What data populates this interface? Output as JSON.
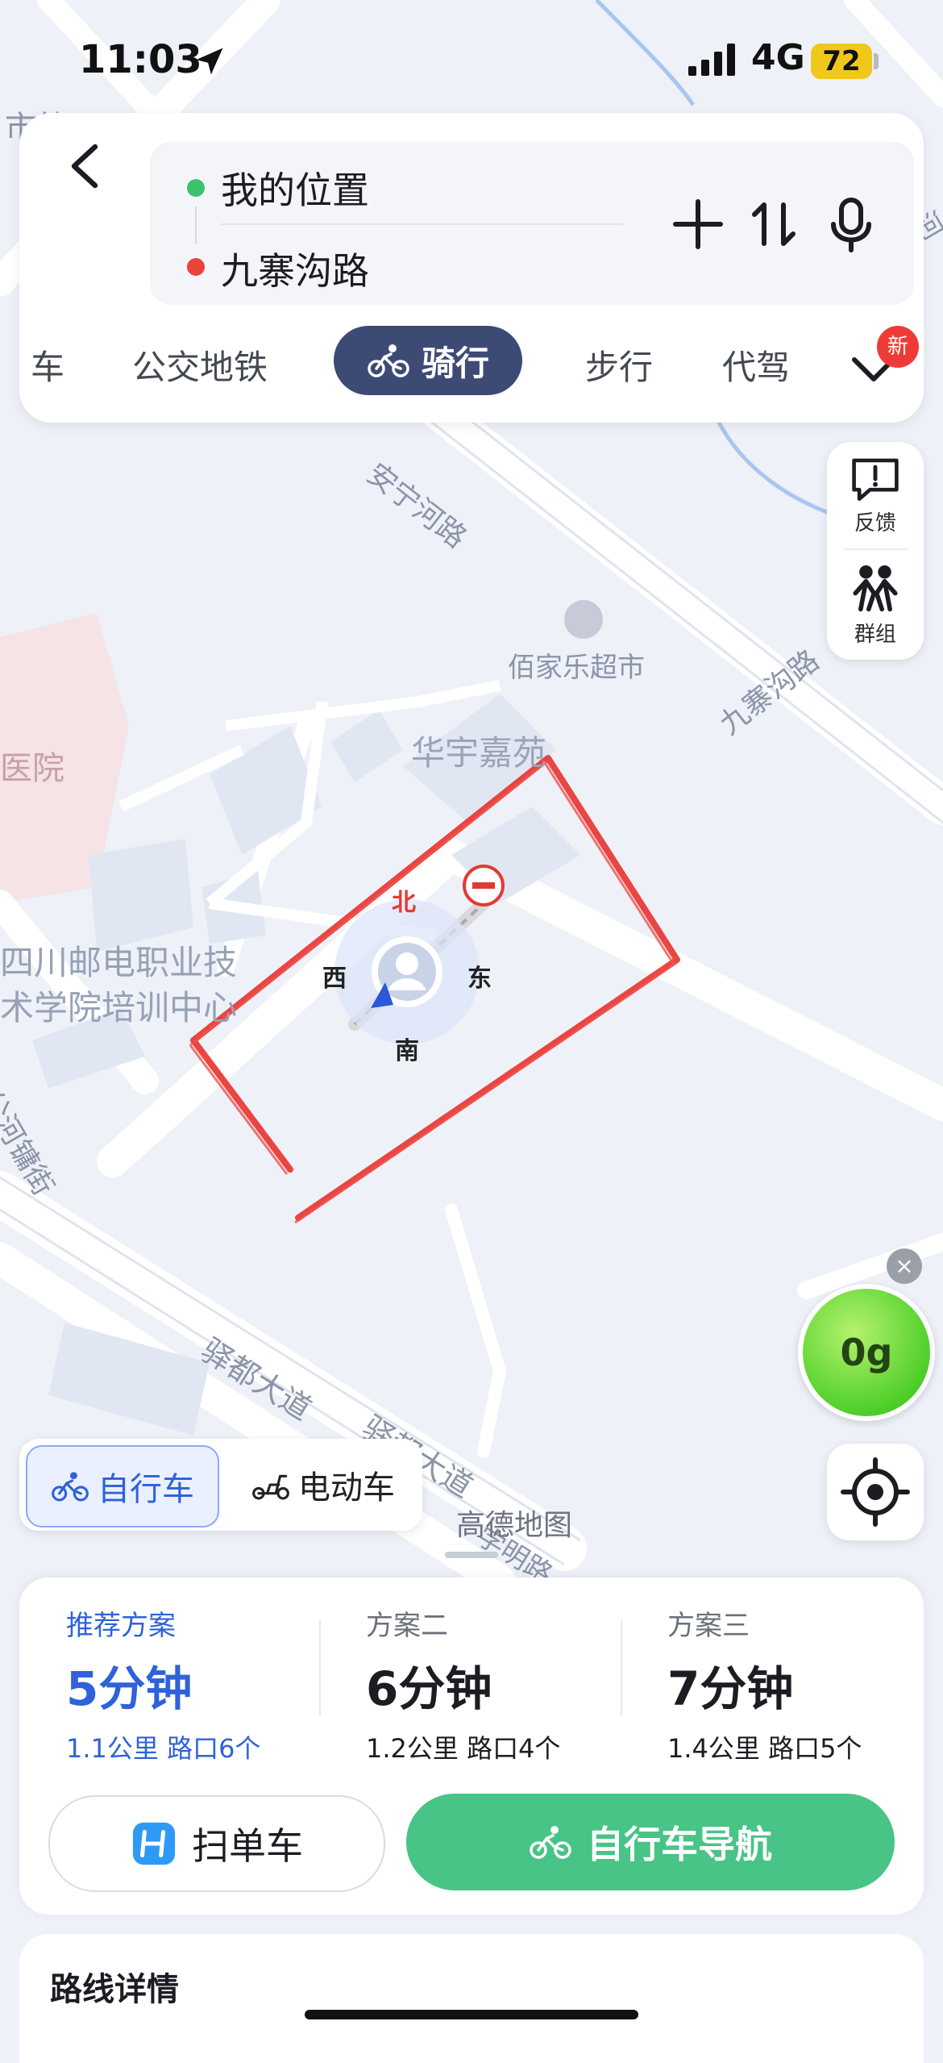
{
  "status_bar": {
    "time": "11:03",
    "network": "4G",
    "battery": "72"
  },
  "route": {
    "from": "我的位置",
    "to": "九寨沟路"
  },
  "tabs": [
    {
      "label": "车"
    },
    {
      "label": "公交地铁"
    },
    {
      "label": "骑行",
      "active": true
    },
    {
      "label": "步行"
    },
    {
      "label": "代驾"
    }
  ],
  "tabs_badge": "新",
  "side_panel": {
    "feedback": "反馈",
    "group": "群组"
  },
  "map": {
    "labels": {
      "road_ningning": "安宁河路",
      "supermarket": "佰家乐超市",
      "jiuzhaigou_road": "九寨沟路",
      "huayu": "华宇嘉苑",
      "hospital": "医院",
      "college_line1": "四川邮电职业技",
      "college_line2": "术学院培训中心",
      "street": "公河镛街",
      "yidu1": "驿都大道",
      "yidu2": "驿都大道",
      "yidu3": "学明路",
      "top_left": "市第二",
      "top_right": "河"
    },
    "compass": {
      "north": "北",
      "south": "南",
      "east": "东",
      "west": "西"
    },
    "logo": "高德地图"
  },
  "eco": {
    "value": "0g"
  },
  "vehicle_toggle": {
    "bike": "自行车",
    "ebike": "电动车"
  },
  "plans": [
    {
      "head": "推荐方案",
      "time": "5分钟",
      "meta": "1.1公里  路口6个",
      "selected": true
    },
    {
      "head": "方案二",
      "time": "6分钟",
      "meta": "1.2公里  路口4个"
    },
    {
      "head": "方案三",
      "time": "7分钟",
      "meta": "1.4公里  路口5个"
    }
  ],
  "actions": {
    "scan": "扫单车",
    "navigate": "自行车导航"
  },
  "details": {
    "title": "路线详情"
  },
  "colors": {
    "primary": "#2f62d9",
    "active_tab": "#3d4b74",
    "nav_green": "#47c486",
    "annotation_red": "#e8322e"
  }
}
